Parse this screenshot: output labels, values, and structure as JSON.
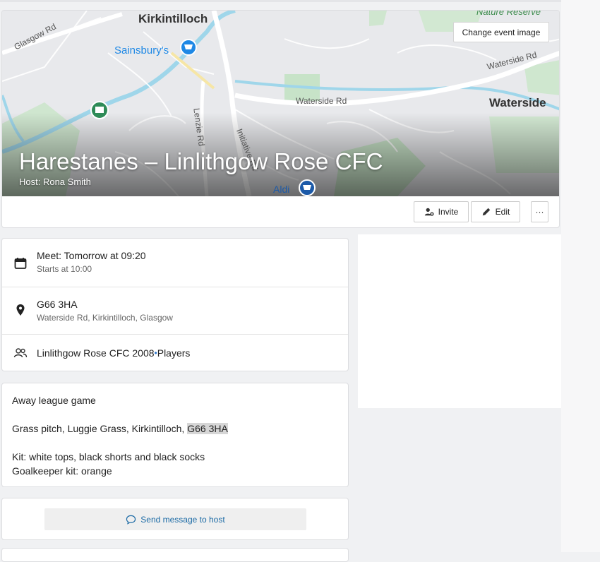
{
  "header": {
    "title": "Harestanes – Linlithgow Rose CFC",
    "host": "Host: Rona Smith",
    "change_image_label": "Change event image",
    "map_labels": {
      "town_north": "Kirkintilloch",
      "store_1": "Sainsbury's",
      "road_1": "Glasgow Rd",
      "road_2": "Waterside Rd",
      "road_3": "Waterside Rd",
      "road_4": "Lenzie Rd",
      "road_5": "Initiative Rd",
      "place_1": "Waterside",
      "store_2": "Aldi",
      "reserve": "Nature Reserve"
    }
  },
  "actions": {
    "invite_label": "Invite",
    "edit_label": "Edit",
    "more_label": "···"
  },
  "details": {
    "meet_main": "Meet: Tomorrow at 09:20",
    "meet_sub": "Starts at 10:00",
    "location_main": "G66 3HA",
    "location_sub": "Waterside Rd, Kirkintilloch, Glasgow",
    "team_name": "Linlithgow Rose CFC 2008",
    "team_dot": "•",
    "team_group": "Players"
  },
  "description": {
    "line1": "Away league game",
    "line2_prefix": "Grass pitch, Luggie Grass, Kirkintilloch, ",
    "line2_highlight": "G66 3HA",
    "line3": "Kit: white tops, black shorts and black socks",
    "line4": "Goalkeeper kit: orange"
  },
  "message": {
    "send_label": "Send message to host"
  },
  "icons": {
    "calendar": "calendar-icon",
    "location": "location-pin-icon",
    "people": "people-icon",
    "invite": "add-person-icon",
    "edit": "pencil-icon",
    "chat": "chat-bubble-icon"
  },
  "colors": {
    "accent_blue": "#1b6aa5",
    "map_water": "#8fd3e8",
    "map_park": "#c8e6c9"
  }
}
